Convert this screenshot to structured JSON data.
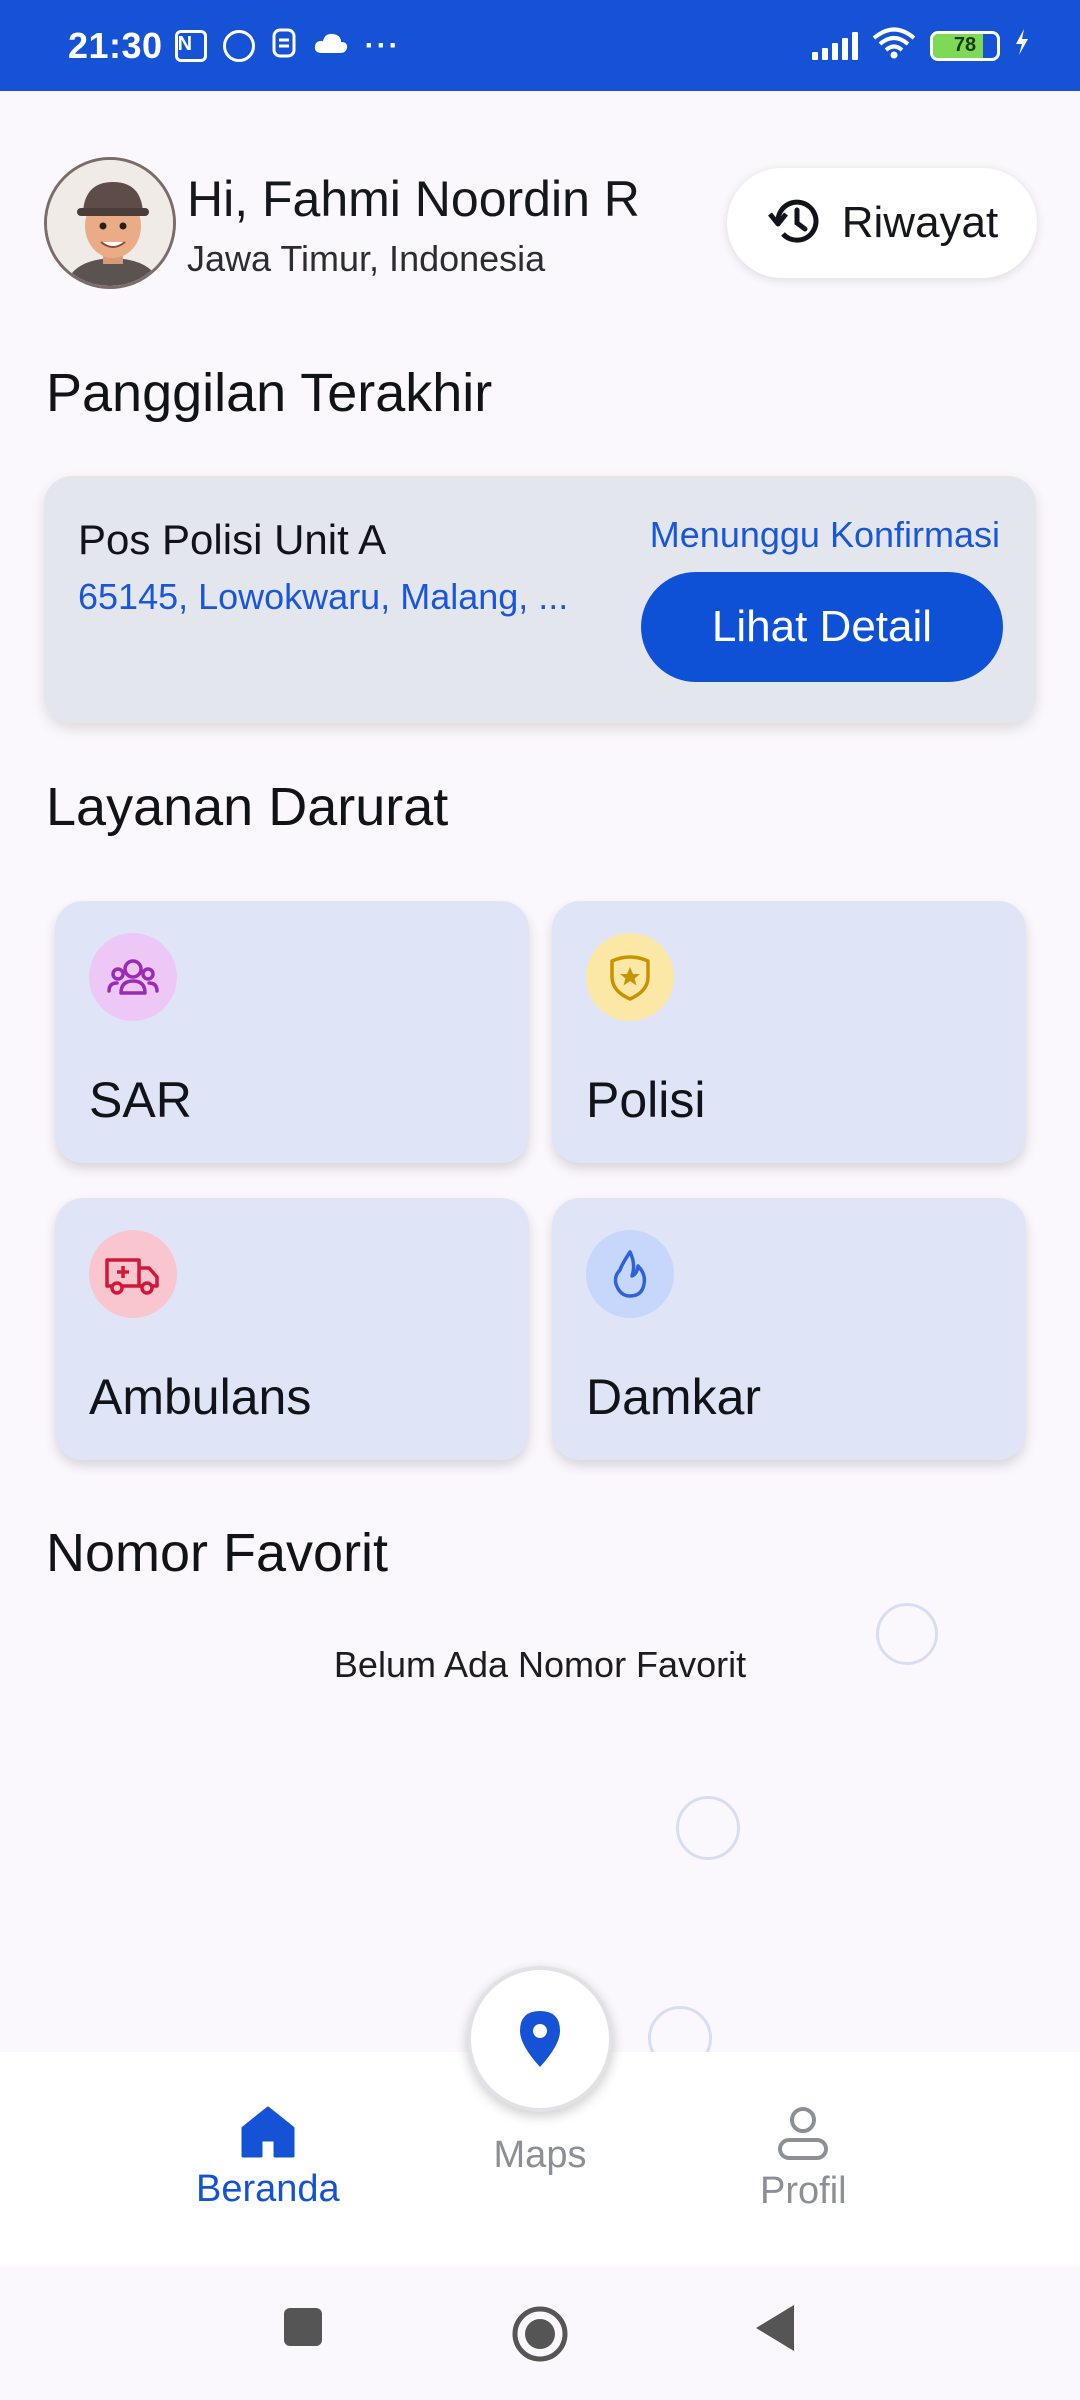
{
  "status_bar": {
    "time": "21:30",
    "battery": "78",
    "battery_level": 0.78,
    "icons": [
      "nfc-icon",
      "whatsapp-icon",
      "notification-icon",
      "cloud-icon",
      "more-dots-icon",
      "signal-icon",
      "wifi-icon",
      "battery-icon",
      "charging-icon"
    ],
    "color": "#1552d6"
  },
  "header": {
    "greeting": "Hi, Fahmi Noordin R",
    "location": "Jawa Timur, Indonesia",
    "history_button": "Riwayat"
  },
  "recent": {
    "title": "Panggilan Terakhir",
    "name": "Pos Polisi Unit A",
    "address": "65145, Lowokwaru, Malang, ...",
    "status": "Menunggu Konfirmasi",
    "detail_button": "Lihat Detail"
  },
  "services": {
    "title": "Layanan Darurat",
    "items": [
      {
        "label": "SAR",
        "icon": "people-group-icon",
        "icon_bg": "#edc8f6",
        "icon_color": "#9b2bb5"
      },
      {
        "label": "Polisi",
        "icon": "police-badge-icon",
        "icon_bg": "#fbe8a6",
        "icon_color": "#c99300"
      },
      {
        "label": "Ambulans",
        "icon": "ambulance-icon",
        "icon_bg": "#f9c6d0",
        "icon_color": "#d1183a"
      },
      {
        "label": "Damkar",
        "icon": "fire-drop-icon",
        "icon_bg": "#c7d7fb",
        "icon_color": "#2d62d8"
      }
    ]
  },
  "favorites": {
    "title": "Nomor Favorit",
    "empty": "Belum Ada Nomor Favorit"
  },
  "bottom_nav": {
    "home": "Beranda",
    "maps": "Maps",
    "profile": "Profil",
    "active_color": "#1552d6",
    "inactive_color": "#8d8f96"
  }
}
